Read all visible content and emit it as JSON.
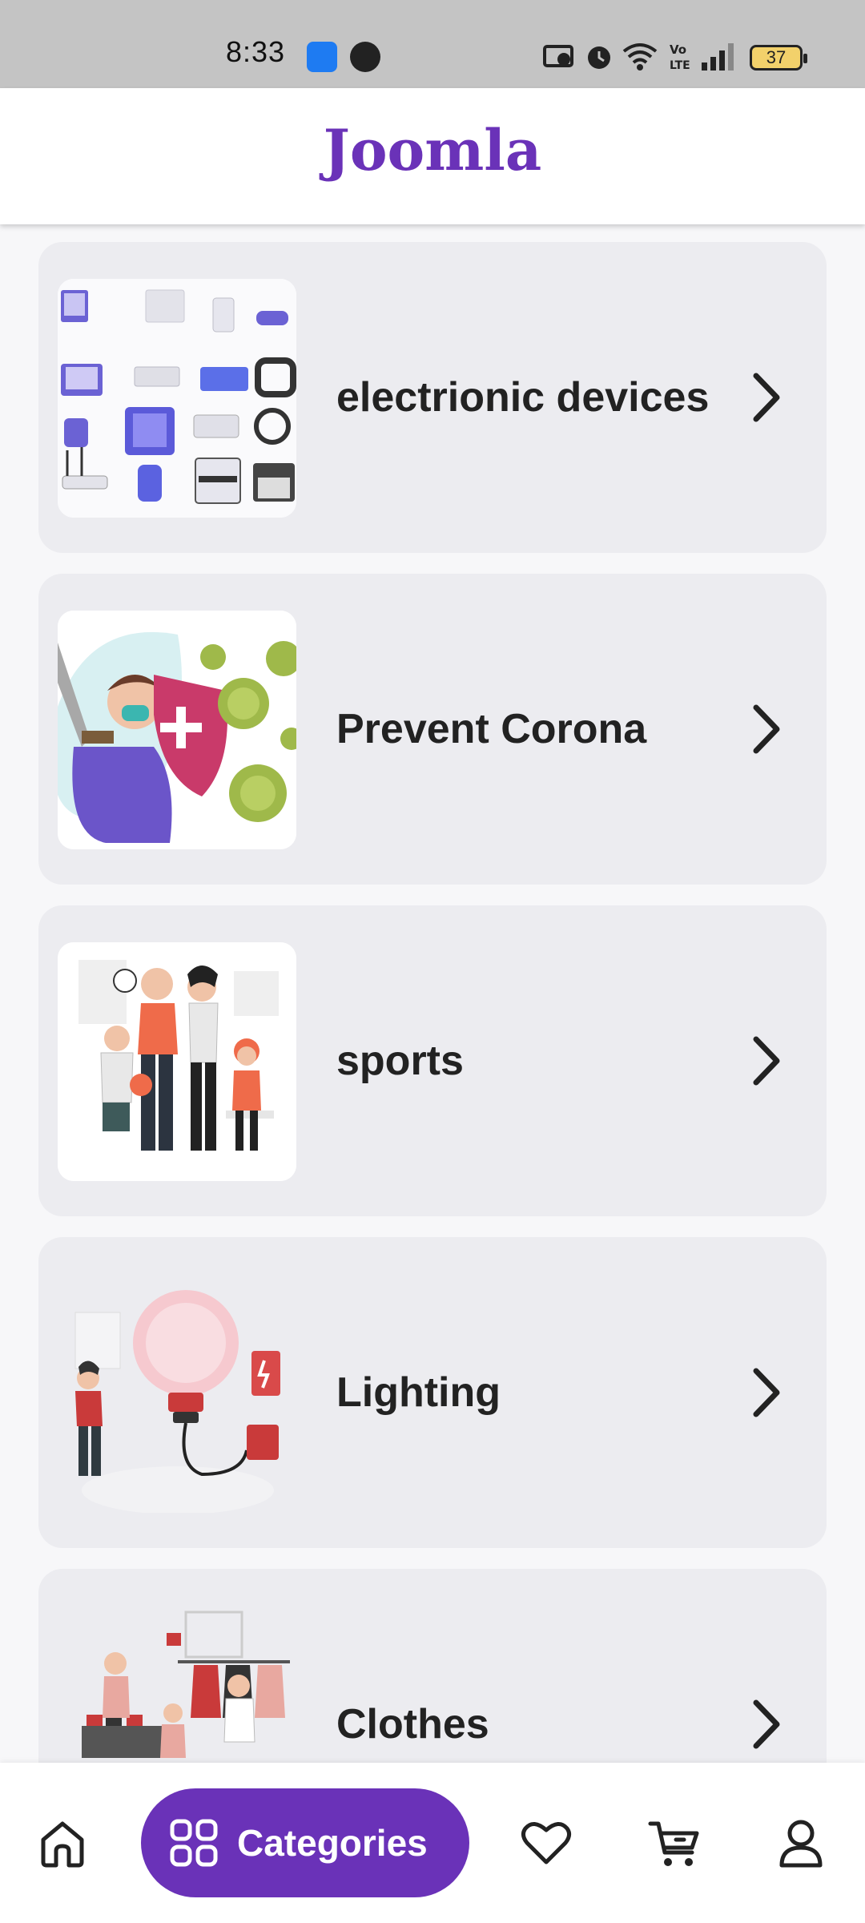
{
  "status_bar": {
    "time": "8:33",
    "battery": "37",
    "icons": [
      "app-notification-icon",
      "app-notification-icon",
      "cast-icon",
      "alarm-icon",
      "wifi-icon",
      "volte-icon",
      "signal-icon",
      "battery-icon"
    ]
  },
  "header": {
    "title": "Joomla"
  },
  "categories": [
    {
      "label": "electrionic devices",
      "icon": "electronics-illustration"
    },
    {
      "label": "Prevent Corona",
      "icon": "virus-shield-illustration"
    },
    {
      "label": "sports",
      "icon": "family-sports-illustration"
    },
    {
      "label": "Lighting",
      "icon": "light-bulb-illustration"
    },
    {
      "label": "Clothes",
      "icon": "clothing-store-illustration"
    }
  ],
  "bottom_nav": {
    "active_label": "Categories",
    "items": [
      "home-icon",
      "categories-icon",
      "heart-icon",
      "cart-icon",
      "profile-icon"
    ]
  },
  "colors": {
    "accent": "#6a32b8",
    "card_bg": "#ececf0",
    "page_bg": "#f7f7f9"
  }
}
